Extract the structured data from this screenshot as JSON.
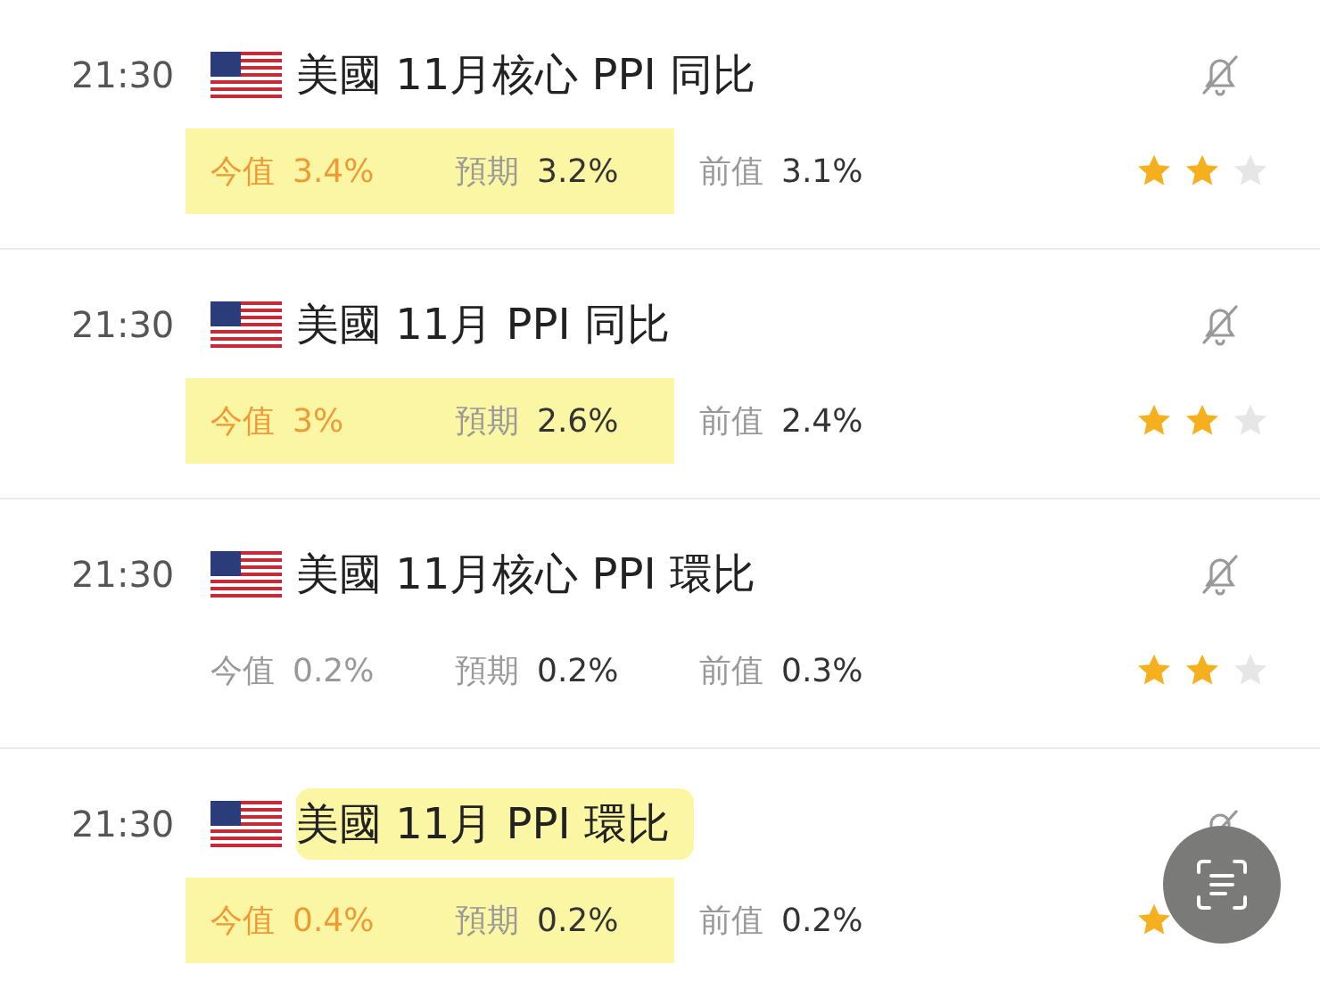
{
  "events": [
    {
      "time": "21:30",
      "country": "美國",
      "title": "11月核心 PPI 同比",
      "title_highlighted": false,
      "stars": 2,
      "values": [
        {
          "label": "今值",
          "value": "3.4%",
          "color": "#ee9a35",
          "highlighted": true
        },
        {
          "label": "預期",
          "value": "3.2%",
          "highlighted": true
        },
        {
          "label": "前值",
          "value": "3.1%",
          "highlighted": false
        }
      ]
    },
    {
      "time": "21:30",
      "country": "美國",
      "title": "11月 PPI 同比",
      "title_highlighted": false,
      "stars": 2,
      "values": [
        {
          "label": "今值",
          "value": "3%",
          "color": "#ee9a35",
          "highlighted": true
        },
        {
          "label": "預期",
          "value": "2.6%",
          "highlighted": true
        },
        {
          "label": "前值",
          "value": "2.4%",
          "highlighted": false
        }
      ]
    },
    {
      "time": "21:30",
      "country": "美國",
      "title": "11月核心 PPI 環比",
      "title_highlighted": false,
      "stars": 2,
      "values": [
        {
          "label": "今值",
          "value": "0.2%",
          "color": "#999999",
          "highlighted": false
        },
        {
          "label": "預期",
          "value": "0.2%",
          "highlighted": false
        },
        {
          "label": "前值",
          "value": "0.3%",
          "highlighted": false
        }
      ]
    },
    {
      "time": "21:30",
      "country": "美國",
      "title": "11月 PPI 環比",
      "title_highlighted": true,
      "values": [
        {
          "label": "今值",
          "value": "0.4%",
          "color": "#ee9a35",
          "highlighted": true
        },
        {
          "label": "預期",
          "value": "0.2%",
          "highlighted": true
        },
        {
          "label": "前值",
          "value": "0.2%",
          "highlighted": false
        }
      ]
    }
  ]
}
